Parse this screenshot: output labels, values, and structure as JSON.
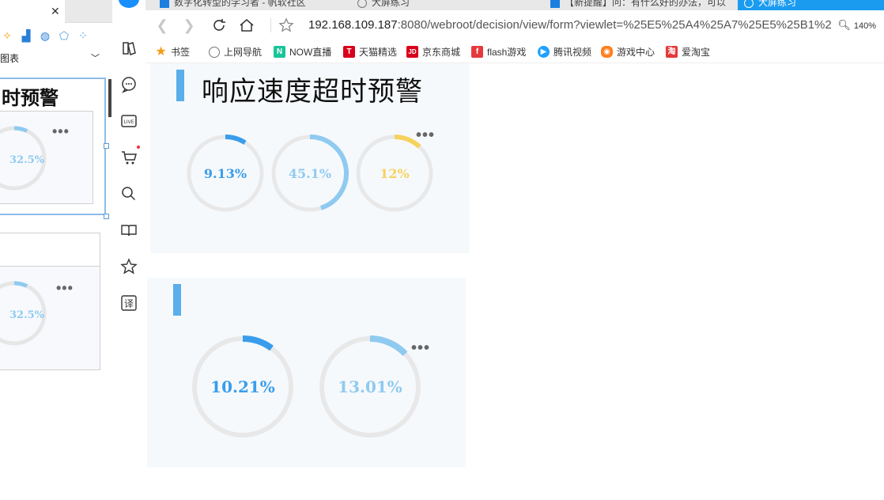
{
  "left_pane": {
    "title_fragment": "时预警",
    "select_label": "图表",
    "ring1_value": "32.5%",
    "ring2_value": "32.5%",
    "colors": {
      "ring_track": "#e6e6e6",
      "ring_fill": "#8fcaf0"
    }
  },
  "tabs": [
    {
      "label": "数字化转型的学习者 - 帆软社区",
      "icon": "fanruan-icon"
    },
    {
      "label": "大屏练习",
      "icon": "globe-icon"
    },
    {
      "label": "【新提醒】问：有什么好的办法，可以",
      "icon": "fanruan-icon"
    },
    {
      "label": "大屏练习",
      "icon": "globe-icon",
      "active": true
    }
  ],
  "address_bar": {
    "host": "192.168.109.187",
    "rest": ":8080/webroot/decision/view/form?viewlet=%25E5%25A4%25A7%25E5%25B1%2",
    "zoom": "140%"
  },
  "bookmarks": [
    {
      "label": "书签",
      "icon": "star-icon",
      "color": "#f39c12"
    },
    {
      "label": "上网导航",
      "icon": "globe-icon",
      "color": "#777777"
    },
    {
      "label": "NOW直播",
      "icon": "now-icon",
      "color": "#19c49a"
    },
    {
      "label": "天猫精选",
      "icon": "tmall-icon",
      "color": "#d9001b"
    },
    {
      "label": "京东商城",
      "icon": "jd-icon",
      "color": "#d9001b"
    },
    {
      "label": "flash游戏",
      "icon": "flash-icon",
      "color": "#e5393c"
    },
    {
      "label": "腾讯视频",
      "icon": "tencent-video-icon",
      "color": "#1fa1ff"
    },
    {
      "label": "游戏中心",
      "icon": "gamepad-icon",
      "color": "#ff7f1f"
    },
    {
      "label": "爱淘宝",
      "icon": "taobao-icon",
      "color": "#e5393c"
    }
  ],
  "panel1": {
    "title": "响应速度超时预警",
    "gauges": [
      {
        "label": "9.13%",
        "value": 9.13,
        "color": "#3a9deb"
      },
      {
        "label": "45.1%",
        "value": 45.1,
        "color": "#8fcaf0"
      },
      {
        "label": "12%",
        "value": 12,
        "color": "#f6d25e"
      }
    ]
  },
  "panel2": {
    "title": "",
    "gauges": [
      {
        "label": "10.21%",
        "value": 10.21,
        "color": "#3a9deb"
      },
      {
        "label": "13.01%",
        "value": 13.01,
        "color": "#8fcaf0"
      }
    ]
  },
  "ring_track_color": "#e8e8e8",
  "more_label": "•••"
}
